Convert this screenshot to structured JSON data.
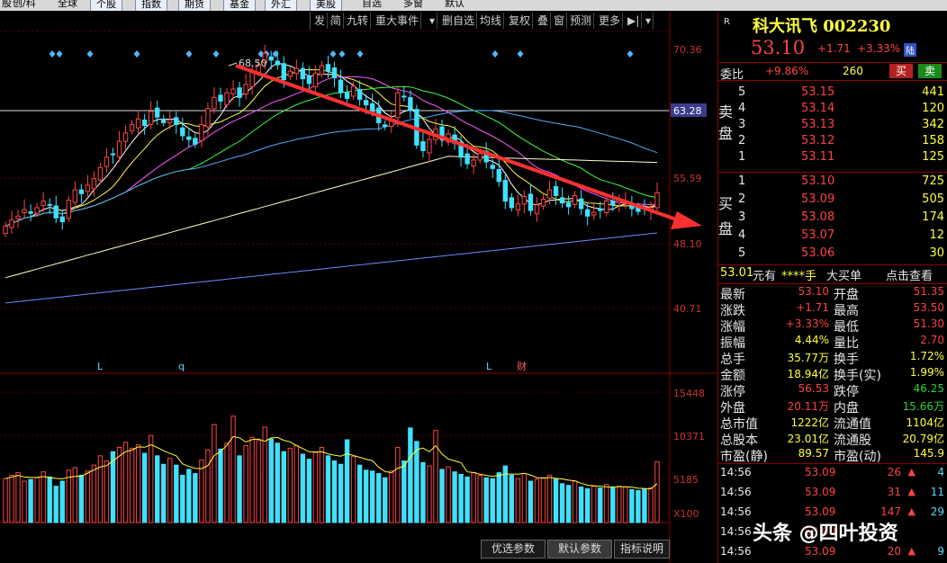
{
  "top_tabs": [
    "股",
    "创/科",
    "全球",
    "个股",
    "指数",
    "期货",
    "基金",
    "外汇",
    "美股",
    "自选",
    "多窗",
    "默认"
  ],
  "toolbar": [
    "发",
    "简",
    "九转",
    "重大事件",
    "▾",
    "删自选",
    "均线",
    "复权",
    "叠",
    "窗",
    "预测",
    "更多",
    "▶|",
    "▾"
  ],
  "chart": {
    "price_axis": [
      "70.36",
      "63.28",
      "55.59",
      "48.10",
      "40.71"
    ],
    "high_label": "68.50",
    "current_line_label": "63.28",
    "markers": [
      "L",
      "q",
      "L",
      "财"
    ],
    "volume_axis": [
      "15448",
      "10371",
      "5185",
      "X100"
    ]
  },
  "chart_data": {
    "type": "candlestick",
    "ylim": [
      40.71,
      70.36
    ],
    "high": 68.5,
    "volume_ylim": [
      0,
      15448
    ],
    "closes": [
      49.5,
      50.2,
      50.6,
      51.3,
      50.9,
      51.5,
      52.2,
      51.8,
      50.4,
      50.0,
      52.3,
      53.4,
      53.0,
      53.9,
      54.6,
      55.8,
      56.9,
      57.2,
      58.6,
      59.5,
      60.4,
      61.0,
      60.3,
      61.8,
      61.2,
      60.6,
      60.9,
      60.4,
      59.2,
      58.8,
      58.3,
      60.4,
      62.1,
      63.3,
      62.9,
      63.8,
      64.2,
      63.3,
      64.7,
      66.0,
      66.8,
      68.0,
      67.3,
      66.8,
      65.2,
      66.1,
      66.4,
      65.3,
      64.8,
      65.9,
      66.7,
      66.1,
      65.4,
      63.8,
      63.2,
      64.5,
      63.1,
      62.5,
      61.8,
      60.6,
      60.2,
      60.9,
      63.8,
      63.4,
      61.9,
      58.2,
      57.6,
      58.8,
      59.9,
      58.9,
      59.4,
      58.4,
      56.9,
      56.2,
      56.6,
      57.3,
      56.4,
      55.7,
      54.3,
      52.2,
      51.5,
      51.9,
      52.7,
      51.2,
      51.8,
      52.4,
      53.4,
      52.8,
      52.0,
      51.6,
      52.8,
      51.4,
      50.6,
      51.0,
      51.2,
      52.2,
      51.8,
      52.3,
      52.1,
      51.4,
      51.1,
      51.4,
      51.5,
      53.1
    ],
    "volumes": [
      5200,
      5600,
      5900,
      4900,
      5100,
      5300,
      6000,
      5400,
      4300,
      4900,
      6200,
      6500,
      5600,
      6100,
      6800,
      7900,
      7300,
      8400,
      8900,
      9500,
      8800,
      9200,
      8200,
      10300,
      7900,
      6900,
      7600,
      6800,
      5600,
      6300,
      5800,
      7400,
      8600,
      11600,
      8700,
      9400,
      8900,
      7900,
      9100,
      10100,
      9700,
      11300,
      9900,
      9400,
      8400,
      8800,
      9100,
      8100,
      7500,
      8300,
      8900,
      7900,
      7300,
      6900,
      6500,
      7800,
      6800,
      6200,
      6100,
      5800,
      5300,
      6100,
      8900,
      7300,
      6400,
      9600,
      7100,
      6700,
      6900,
      6300,
      6600,
      6000,
      5700,
      5400,
      5900,
      5600,
      5300,
      5200,
      5900,
      6700,
      5600,
      5200,
      5800,
      4900,
      5100,
      5300,
      5600,
      5200,
      4600,
      4400,
      4900,
      4200,
      4000,
      4300,
      4100,
      4500,
      4100,
      4300,
      4200,
      3900,
      3800,
      4000,
      4100,
      7200
    ],
    "volume_spikes": [
      [
        36,
        12600
      ],
      [
        54,
        9800
      ],
      [
        64,
        11200
      ],
      [
        68,
        10900
      ],
      [
        108,
        6700
      ]
    ]
  },
  "quote": {
    "r_mark": "R",
    "name": "科大讯飞 002230",
    "price": "53.10",
    "change": "+1.71",
    "pct": "+3.33%",
    "lu": "陆",
    "wb_label": "委比",
    "wb_pct": "+9.86%",
    "wb_val": "260",
    "buy_btn": "买",
    "sell_btn": "卖",
    "sell_side": "卖盘",
    "buy_side": "买盘",
    "asks": [
      {
        "n": "5",
        "p": "53.15",
        "v": "441"
      },
      {
        "n": "4",
        "p": "53.14",
        "v": "120"
      },
      {
        "n": "3",
        "p": "53.13",
        "v": "342"
      },
      {
        "n": "2",
        "p": "53.12",
        "v": "158"
      },
      {
        "n": "1",
        "p": "53.11",
        "v": "125"
      }
    ],
    "bids": [
      {
        "n": "1",
        "p": "53.10",
        "v": "725"
      },
      {
        "n": "2",
        "p": "53.09",
        "v": "505"
      },
      {
        "n": "3",
        "p": "53.08",
        "v": "174"
      },
      {
        "n": "4",
        "p": "53.07",
        "v": "12"
      },
      {
        "n": "5",
        "p": "53.06",
        "v": "30"
      }
    ],
    "big_order": {
      "price": "53.01",
      "unit": "元有",
      "stars": "****手",
      "text": "大买单",
      "link": "点击查看"
    },
    "stats": [
      {
        "l1": "最新",
        "v1": "53.10",
        "c1": "red",
        "l2": "开盘",
        "v2": "51.35",
        "c2": "red"
      },
      {
        "l1": "涨跌",
        "v1": "+1.71",
        "c1": "red",
        "l2": "最高",
        "v2": "53.50",
        "c2": "red"
      },
      {
        "l1": "涨幅",
        "v1": "+3.33%",
        "c1": "red",
        "l2": "最低",
        "v2": "51.30",
        "c2": "red"
      },
      {
        "l1": "振幅",
        "v1": "4.44%",
        "c1": "ylw",
        "l2": "量比",
        "v2": "2.70",
        "c2": "red"
      },
      {
        "l1": "总手",
        "v1": "35.77万",
        "c1": "ylw",
        "l2": "换手",
        "v2": "1.72%",
        "c2": "ylw"
      },
      {
        "l1": "金额",
        "v1": "18.94亿",
        "c1": "ylw",
        "l2": "换手(实)",
        "v2": "1.99%",
        "c2": "ylw"
      },
      {
        "l1": "涨停",
        "v1": "56.53",
        "c1": "red",
        "l2": "跌停",
        "v2": "46.25",
        "c2": "grn"
      },
      {
        "l1": "外盘",
        "v1": "20.11万",
        "c1": "red",
        "l2": "内盘",
        "v2": "15.66万",
        "c2": "grn"
      },
      {
        "l1": "总市值",
        "v1": "1222亿",
        "c1": "ylw",
        "l2": "流通值",
        "v2": "1104亿",
        "c2": "ylw"
      },
      {
        "l1": "总股本",
        "v1": "23.01亿",
        "c1": "ylw",
        "l2": "流通股",
        "v2": "20.79亿",
        "c2": "ylw"
      },
      {
        "l1": "市盈(静)",
        "v1": "89.57",
        "c1": "ylw",
        "l2": "市盈(动)",
        "v2": "145.9",
        "c2": "ylw"
      }
    ],
    "ticks": [
      {
        "t": "14:56",
        "p": "53.09",
        "v": "26",
        "n": "4"
      },
      {
        "t": "14:56",
        "p": "53.09",
        "v": "31",
        "n": "11"
      },
      {
        "t": "14:56",
        "p": "53.09",
        "v": "147",
        "n": "29"
      },
      {
        "t": "14:56",
        "p": "53.09",
        "v": "",
        "n": ""
      },
      {
        "t": "14:56",
        "p": "53.09",
        "v": "20",
        "n": "9"
      }
    ]
  },
  "bottom_buttons": [
    "优选参数",
    "默认参数",
    "指标说明"
  ],
  "watermark": "头条 @四叶投资"
}
